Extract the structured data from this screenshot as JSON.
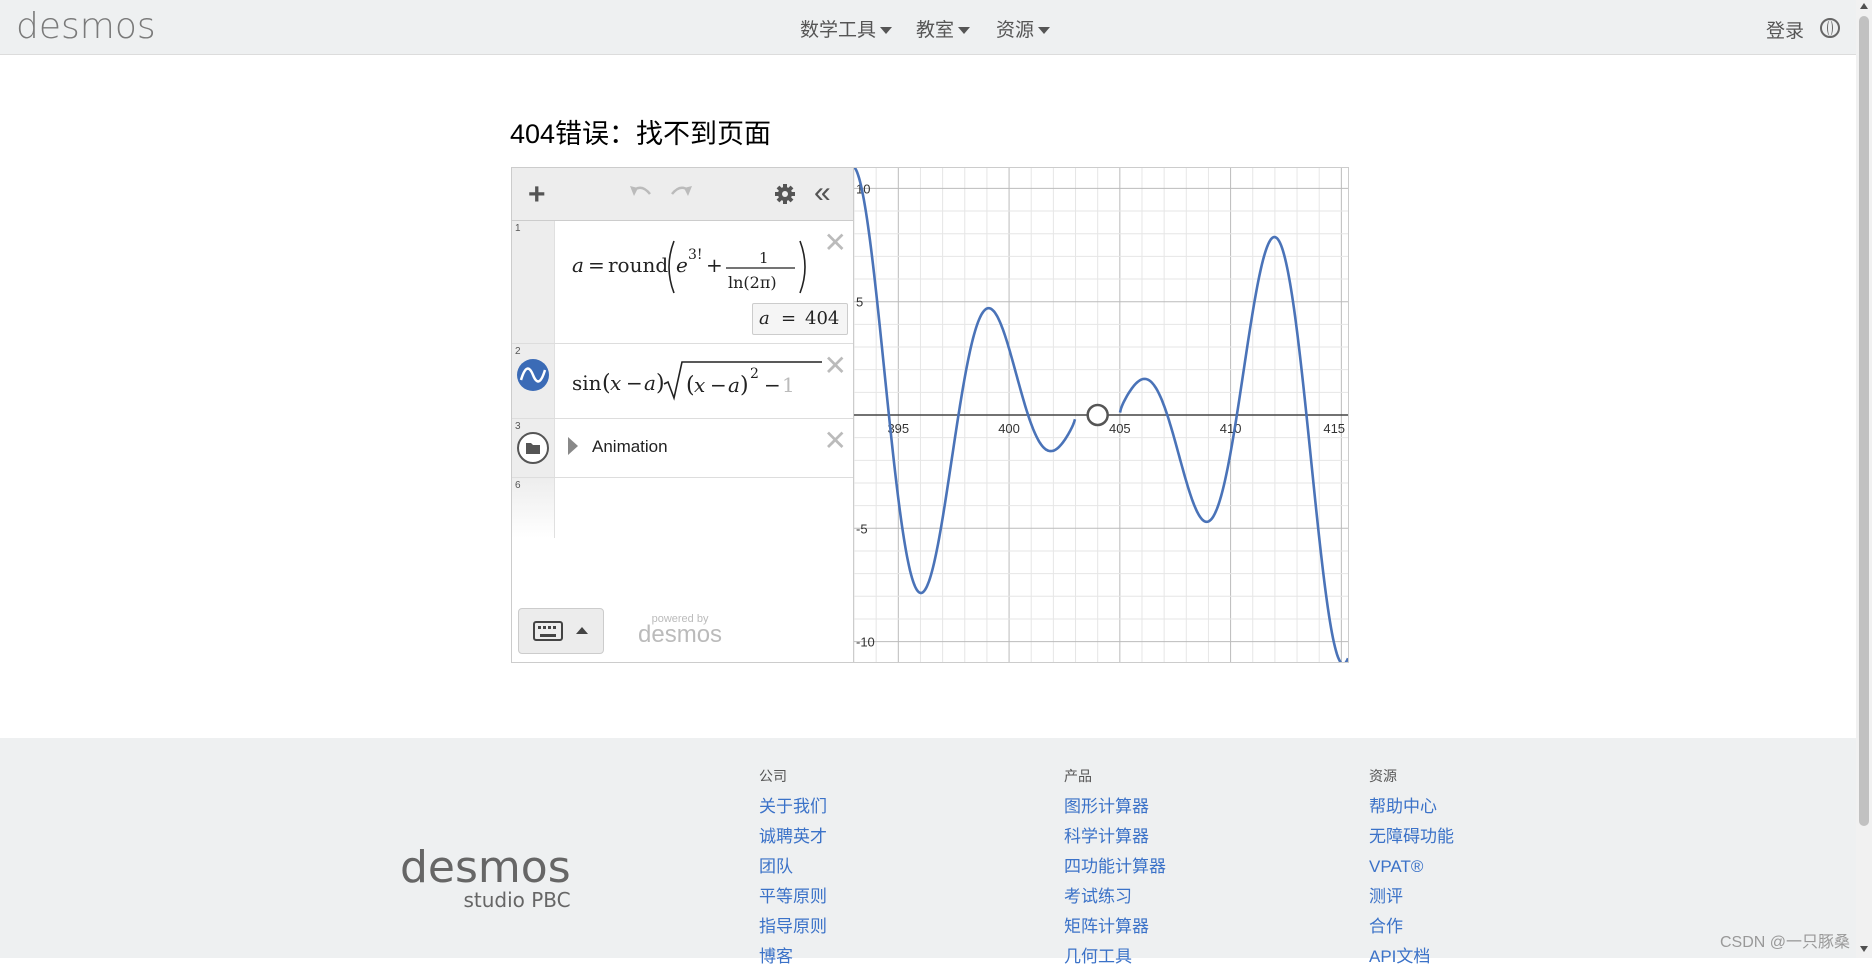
{
  "header": {
    "logo": "desmos",
    "nav": [
      {
        "label": "数学工具"
      },
      {
        "label": "教室"
      },
      {
        "label": "资源"
      }
    ],
    "login": "登录",
    "globe_icon": "globe-icon"
  },
  "page": {
    "title": "404错误：找不到页面"
  },
  "calculator": {
    "toolbar": {
      "add": "+",
      "undo_icon": "undo-icon",
      "redo_icon": "redo-icon",
      "settings_icon": "gear-icon",
      "collapse": "«"
    },
    "expressions": [
      {
        "num": "1",
        "latex": "a = round(e^{3!} + 1/ln(2π))",
        "result_label": "a",
        "result_eq": "=",
        "result_value": "404"
      },
      {
        "num": "2",
        "latex": "sin(x − a)√((x − a)^2 − 1",
        "icon": "wave-icon",
        "color": "#3b6bb6"
      },
      {
        "num": "3",
        "label": "Animation",
        "icon": "folder-icon"
      },
      {
        "num": "6"
      }
    ],
    "powered_by": "powered by",
    "powered_logo": "desmos",
    "graph": {
      "x_ticks": [
        "395",
        "400",
        "405",
        "410",
        "415"
      ],
      "y_ticks": [
        "10",
        "5",
        "-5",
        "-10"
      ],
      "curve_color": "#4a73b8"
    }
  },
  "footer": {
    "logo_main": "desmos",
    "logo_sub": "studio PBC",
    "columns": [
      {
        "title": "公司",
        "links": [
          "关于我们",
          "诚聘英才",
          "团队",
          "平等原则",
          "指导原则",
          "博客"
        ]
      },
      {
        "title": "产品",
        "links": [
          "图形计算器",
          "科学计算器",
          "四功能计算器",
          "考试练习",
          "矩阵计算器",
          "几何工具"
        ]
      },
      {
        "title": "资源",
        "links": [
          "帮助中心",
          "无障碍功能",
          "VPAT®",
          "测评",
          "合作",
          "API文档"
        ]
      }
    ]
  },
  "watermark": "CSDN @一只豚桑"
}
